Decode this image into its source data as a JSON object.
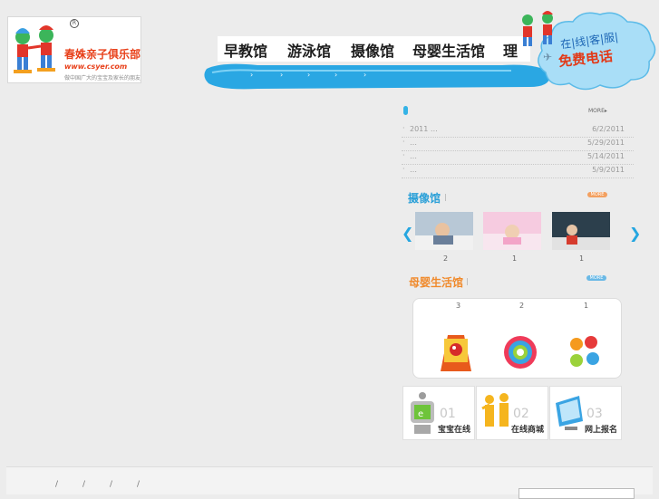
{
  "brand": {
    "name": "春姝亲子俱乐部",
    "url": "www.csyer.com",
    "tagline": "做中国广大的宝宝及家长的朋友",
    "registered": "R"
  },
  "nav": {
    "items": [
      "早教馆",
      "游泳馆",
      "摄像馆",
      "母婴生活馆",
      "理"
    ],
    "sub_arrows": [
      "›",
      "›",
      "›",
      "›",
      "›"
    ]
  },
  "service": {
    "online": "在|线|客|服|",
    "phone": "免费电话"
  },
  "news": {
    "more": "MORE▸",
    "items": [
      {
        "bullet": "·",
        "title": "2011    …",
        "date": "6/2/2011"
      },
      {
        "bullet": "·",
        "title": "        …",
        "date": "5/29/2011"
      },
      {
        "bullet": "·",
        "title": "        …",
        "date": "5/14/2011"
      },
      {
        "bullet": "·",
        "title": "   …",
        "date": "5/9/2011"
      }
    ]
  },
  "photo_section": {
    "title": "摄像馆",
    "more": "MORE",
    "counts": [
      "2",
      "1",
      "1"
    ],
    "prev": "❮",
    "next": "❯"
  },
  "life_section": {
    "title": "母婴生活馆",
    "more": "MORE",
    "counts": [
      "3",
      "2",
      "1"
    ]
  },
  "tiles": [
    {
      "num": "01",
      "label": "宝宝在线",
      "icon": "robot-icon"
    },
    {
      "num": "02",
      "label": "在线商城",
      "icon": "family-icon"
    },
    {
      "num": "03",
      "label": "网上报名",
      "icon": "monitor-icon"
    }
  ],
  "footer": {
    "separators": [
      "/",
      "/",
      "/",
      "/"
    ]
  },
  "colors": {
    "accent": "#25a6e0",
    "brand_red": "#e8401a",
    "photo_title": "#2ba0d8",
    "life_title": "#f08a2c"
  }
}
